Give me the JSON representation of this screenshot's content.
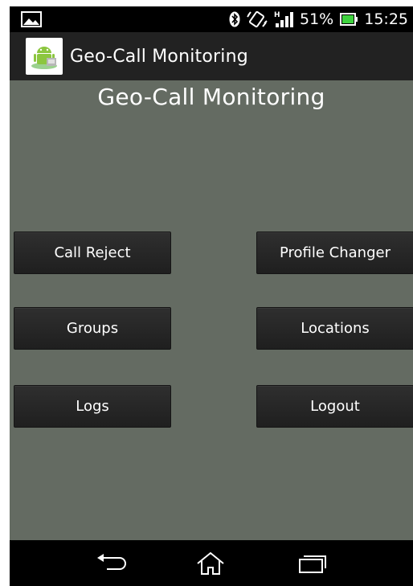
{
  "status_bar": {
    "battery": "51%",
    "time": "15:25",
    "icons": [
      "picture-icon",
      "bluetooth-icon",
      "vibrate-icon",
      "signal-icon",
      "battery-icon"
    ],
    "signal_label": "H"
  },
  "action_bar": {
    "logo_icon": "android-app-icon",
    "title": "Geo-Call Monitoring"
  },
  "main": {
    "heading": "Geo-Call Monitoring",
    "buttons": {
      "call_reject": "Call Reject",
      "profile_changer": "Profile Changer",
      "groups": "Groups",
      "locations": "Locations",
      "logs": "Logs",
      "logout": "Logout"
    }
  },
  "nav_bar": {
    "icons": [
      "back-icon",
      "home-icon",
      "recent-apps-icon"
    ]
  },
  "colors": {
    "content_bg": "#646b62",
    "action_bar_bg": "#222222",
    "button_bg": "#262626",
    "battery_green": "#3fd33f"
  }
}
